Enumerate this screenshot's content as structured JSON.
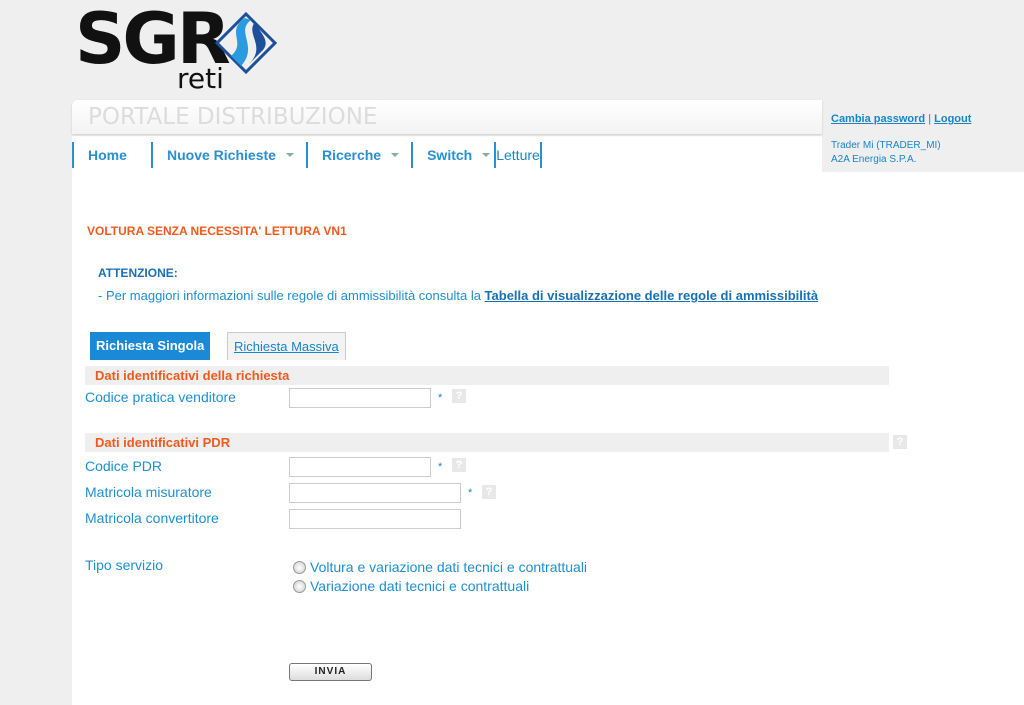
{
  "logo": {
    "text": "SGR",
    "sub": "reti"
  },
  "header": {
    "portal_title": "PORTALE DISTRIBUZIONE",
    "change_password": "Cambia password",
    "separator": "|",
    "logout": "Logout",
    "user_name": "Trader Mi (TRADER_MI)",
    "company": "A2A Energia S.P.A."
  },
  "nav": [
    {
      "label": "Home"
    },
    {
      "label": "Nuove Richieste",
      "dropdown": true
    },
    {
      "label": "Ricerche",
      "dropdown": true
    },
    {
      "label": "Switch",
      "dropdown": true
    },
    {
      "label": "Letture"
    }
  ],
  "page": {
    "title": "VOLTURA SENZA NECESSITA' LETTURA VN1",
    "attention": "ATTENZIONE:",
    "info_text": "- Per maggiori informazioni sulle regole di ammissibilità consulta la ",
    "info_link": "Tabella di visualizzazione delle regole di ammissibilità"
  },
  "tabs": [
    {
      "label": "Richiesta Singola",
      "active": true
    },
    {
      "label": "Richiesta Massiva",
      "active": false
    }
  ],
  "sections": {
    "richiesta": "Dati identificativi della richiesta",
    "pdr": "Dati identificativi PDR"
  },
  "fields": {
    "codice_pratica": {
      "label": "Codice pratica venditore",
      "value": "",
      "required": "*"
    },
    "codice_pdr": {
      "label": "Codice PDR",
      "value": "",
      "required": "*"
    },
    "matricola_misuratore": {
      "label": "Matricola misuratore",
      "value": "",
      "required": "*"
    },
    "matricola_convertitore": {
      "label": "Matricola convertitore",
      "value": ""
    }
  },
  "help": "?",
  "tipo_servizio": {
    "label": "Tipo servizio",
    "options": [
      "Voltura e variazione dati tecnici e contrattuali",
      "Variazione dati tecnici e contrattuali"
    ],
    "selected": null
  },
  "submit": "INVIA",
  "colors": {
    "accent": "#1e8fd0",
    "heading": "#f05a1e"
  }
}
